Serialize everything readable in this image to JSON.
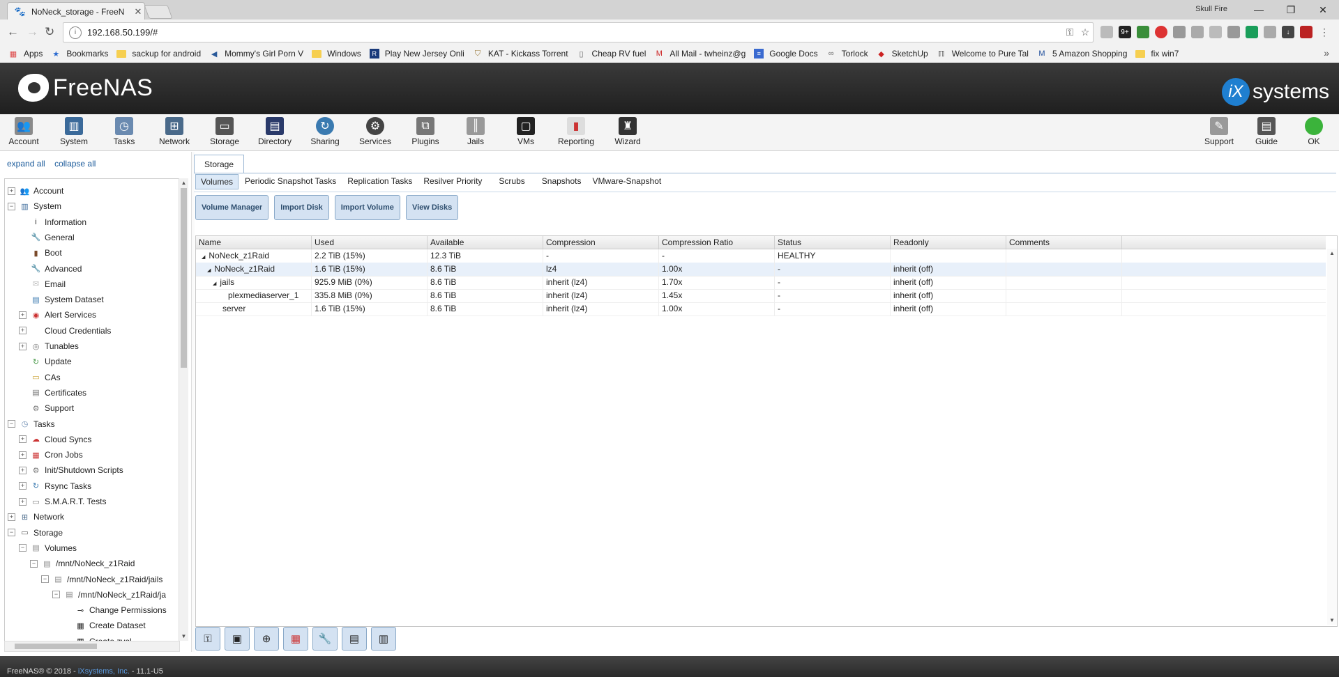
{
  "browser": {
    "tab_title": "NoNeck_storage - FreeN",
    "user": "Skull Fire",
    "url": "192.168.50.199/#"
  },
  "bookmarks": [
    "Apps",
    "Bookmarks",
    "sackup for android",
    "Mommy's Girl Porn V",
    "Windows",
    "Play New Jersey Onli",
    "KAT - Kickass Torrent",
    "Cheap RV fuel",
    "All Mail - twheinz@g",
    "Google Docs",
    "Torlock",
    "SketchUp",
    "Welcome to Pure Tal",
    "5 Amazon Shopping",
    "fix win7"
  ],
  "header": {
    "logo": "FreeNAS",
    "brand": "systems",
    "brand_prefix": "iX"
  },
  "toolbar": {
    "left": [
      "Account",
      "System",
      "Tasks",
      "Network",
      "Storage",
      "Directory",
      "Sharing",
      "Services",
      "Plugins",
      "Jails",
      "VMs",
      "Reporting",
      "Wizard"
    ],
    "right": [
      "Support",
      "Guide",
      "OK"
    ]
  },
  "tree": {
    "expand_all": "expand all",
    "collapse_all": "collapse all",
    "items": [
      {
        "label": "Account",
        "level": 0,
        "exp": "+"
      },
      {
        "label": "System",
        "level": 0,
        "exp": "−"
      },
      {
        "label": "Information",
        "level": 1,
        "exp": ""
      },
      {
        "label": "General",
        "level": 1,
        "exp": ""
      },
      {
        "label": "Boot",
        "level": 1,
        "exp": ""
      },
      {
        "label": "Advanced",
        "level": 1,
        "exp": ""
      },
      {
        "label": "Email",
        "level": 1,
        "exp": ""
      },
      {
        "label": "System Dataset",
        "level": 1,
        "exp": ""
      },
      {
        "label": "Alert Services",
        "level": 1,
        "exp": "+"
      },
      {
        "label": "Cloud Credentials",
        "level": 1,
        "exp": "+"
      },
      {
        "label": "Tunables",
        "level": 1,
        "exp": "+"
      },
      {
        "label": "Update",
        "level": 1,
        "exp": ""
      },
      {
        "label": "CAs",
        "level": 1,
        "exp": ""
      },
      {
        "label": "Certificates",
        "level": 1,
        "exp": ""
      },
      {
        "label": "Support",
        "level": 1,
        "exp": ""
      },
      {
        "label": "Tasks",
        "level": 0,
        "exp": "−"
      },
      {
        "label": "Cloud Syncs",
        "level": 1,
        "exp": "+"
      },
      {
        "label": "Cron Jobs",
        "level": 1,
        "exp": "+"
      },
      {
        "label": "Init/Shutdown Scripts",
        "level": 1,
        "exp": "+"
      },
      {
        "label": "Rsync Tasks",
        "level": 1,
        "exp": "+"
      },
      {
        "label": "S.M.A.R.T. Tests",
        "level": 1,
        "exp": "+"
      },
      {
        "label": "Network",
        "level": 0,
        "exp": "+"
      },
      {
        "label": "Storage",
        "level": 0,
        "exp": "−"
      },
      {
        "label": "Volumes",
        "level": 1,
        "exp": "−"
      },
      {
        "label": "/mnt/NoNeck_z1Raid",
        "level": 2,
        "exp": "−"
      },
      {
        "label": "/mnt/NoNeck_z1Raid/jails",
        "level": 3,
        "exp": "−"
      },
      {
        "label": "/mnt/NoNeck_z1Raid/ja",
        "level": 4,
        "exp": "−"
      },
      {
        "label": "Change Permissions",
        "level": 5,
        "exp": ""
      },
      {
        "label": "Create Dataset",
        "level": 5,
        "exp": ""
      },
      {
        "label": "Create zvol",
        "level": 5,
        "exp": ""
      }
    ]
  },
  "main": {
    "tab": "Storage",
    "subtabs": [
      "Volumes",
      "Periodic Snapshot Tasks",
      "Replication Tasks",
      "Resilver Priority",
      "Scrubs",
      "Snapshots",
      "VMware-Snapshot"
    ],
    "buttons": [
      "Volume Manager",
      "Import Disk",
      "Import Volume",
      "View Disks"
    ],
    "columns": [
      "Name",
      "Used",
      "Available",
      "Compression",
      "Compression Ratio",
      "Status",
      "Readonly",
      "Comments"
    ],
    "rows": [
      {
        "name": "NoNeck_z1Raid",
        "indent": 0,
        "arrow": "◢",
        "used": "2.2 TiB (15%)",
        "available": "12.3 TiB",
        "compression": "-",
        "ratio": "-",
        "status": "HEALTHY",
        "readonly": "",
        "comments": ""
      },
      {
        "name": "NoNeck_z1Raid",
        "indent": 1,
        "arrow": "◢",
        "used": "1.6 TiB (15%)",
        "available": "8.6 TiB",
        "compression": "lz4",
        "ratio": "1.00x",
        "status": "-",
        "readonly": "inherit (off)",
        "comments": ""
      },
      {
        "name": "jails",
        "indent": 2,
        "arrow": "◢",
        "used": "925.9 MiB (0%)",
        "available": "8.6 TiB",
        "compression": "inherit (lz4)",
        "ratio": "1.70x",
        "status": "-",
        "readonly": "inherit (off)",
        "comments": ""
      },
      {
        "name": "plexmediaserver_1",
        "indent": 3,
        "arrow": "",
        "used": "335.8 MiB (0%)",
        "available": "8.6 TiB",
        "compression": "inherit (lz4)",
        "ratio": "1.45x",
        "status": "-",
        "readonly": "inherit (off)",
        "comments": ""
      },
      {
        "name": "server",
        "indent": 2,
        "arrow": "",
        "used": "1.6 TiB (15%)",
        "available": "8.6 TiB",
        "compression": "inherit (lz4)",
        "ratio": "1.00x",
        "status": "-",
        "readonly": "inherit (off)",
        "comments": ""
      }
    ]
  },
  "footer": {
    "copyright": "FreeNAS® © 2018 - ",
    "company": "iXsystems, Inc.",
    "version": " - 11.1-U5"
  }
}
